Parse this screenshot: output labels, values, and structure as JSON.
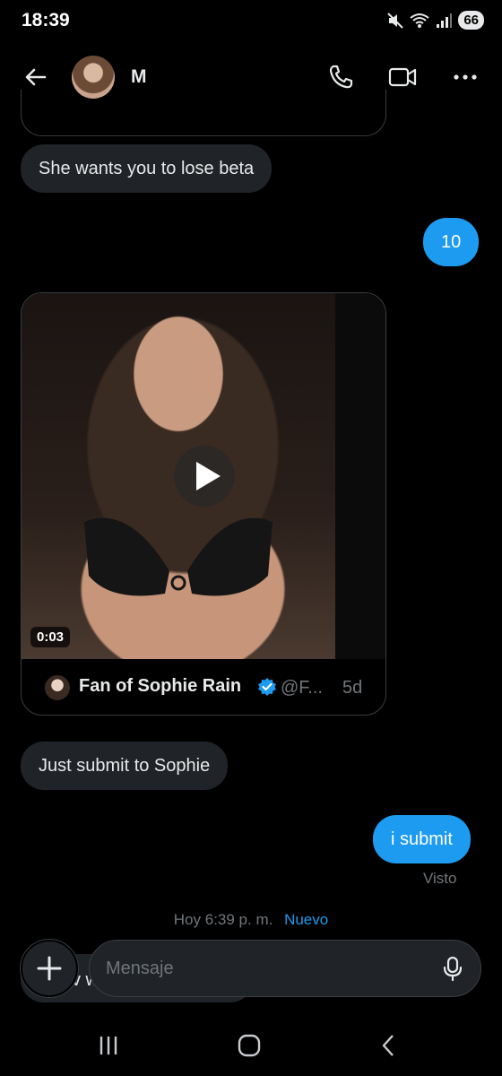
{
  "status_bar": {
    "time": "18:39",
    "battery": "66"
  },
  "header": {
    "contact_name": "M"
  },
  "messages": {
    "m1": "She wants you to lose beta",
    "m2": "10",
    "m3": "Just submit to Sophie",
    "m4": "i submit",
    "m5_partial": "v w"
  },
  "tweet": {
    "author": "Fan of Sophie Rain",
    "handle": "@F...",
    "age": "5d",
    "video_duration": "0:03"
  },
  "seen_label": "Visto",
  "timestamp": {
    "time": "Hoy 6:39 p. m.",
    "new_label": "Nuevo"
  },
  "composer": {
    "placeholder": "Mensaje"
  },
  "colors": {
    "accent": "#1d9bf0",
    "bubble_in": "#202327",
    "background": "#000000",
    "muted": "#71767b"
  }
}
